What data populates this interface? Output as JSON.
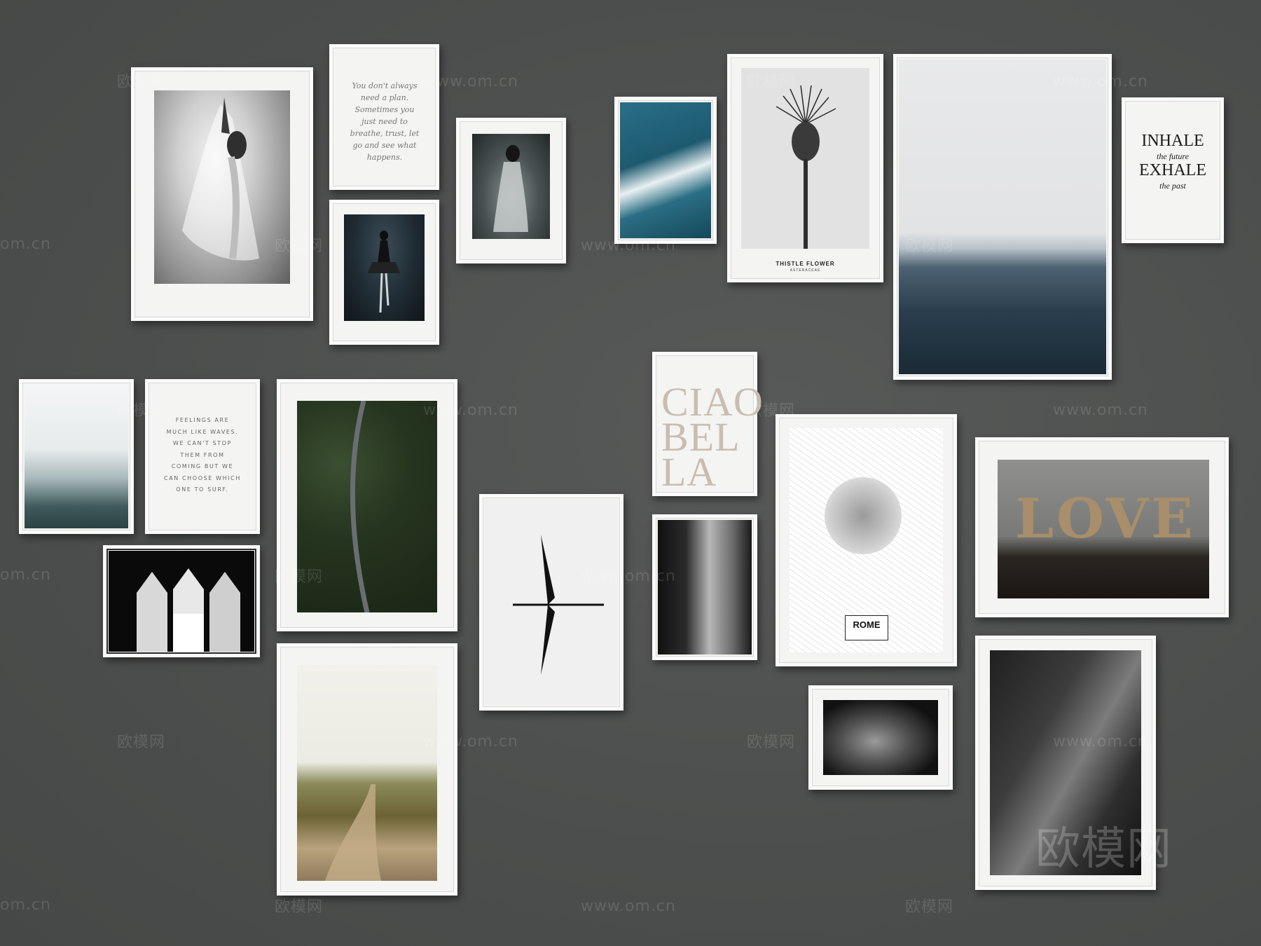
{
  "poem_text": "You don't always need a plan. Sometimes you just need to breathe, trust, let go and see what happens.",
  "quote_text": "FEELINGS ARE MUCH LIKE WAVES. WE CAN'T STOP THEM FROM COMING BUT WE CAN CHOOSE WHICH ONE TO SURF.",
  "thistle_title": "THISTLE FLOWER",
  "thistle_sub": "ASTERACEAE",
  "inhale": "INHALE",
  "inhale_sub": "the future",
  "exhale": "EXHALE",
  "exhale_sub": "the past",
  "ciao_lines": [
    "CIAO",
    "BEL",
    "LA"
  ],
  "rome": "ROME",
  "love": "LOVE",
  "watermark_site": "www.om.cn",
  "watermark_logo": "欧模网",
  "watermark_partial": "om.cn"
}
